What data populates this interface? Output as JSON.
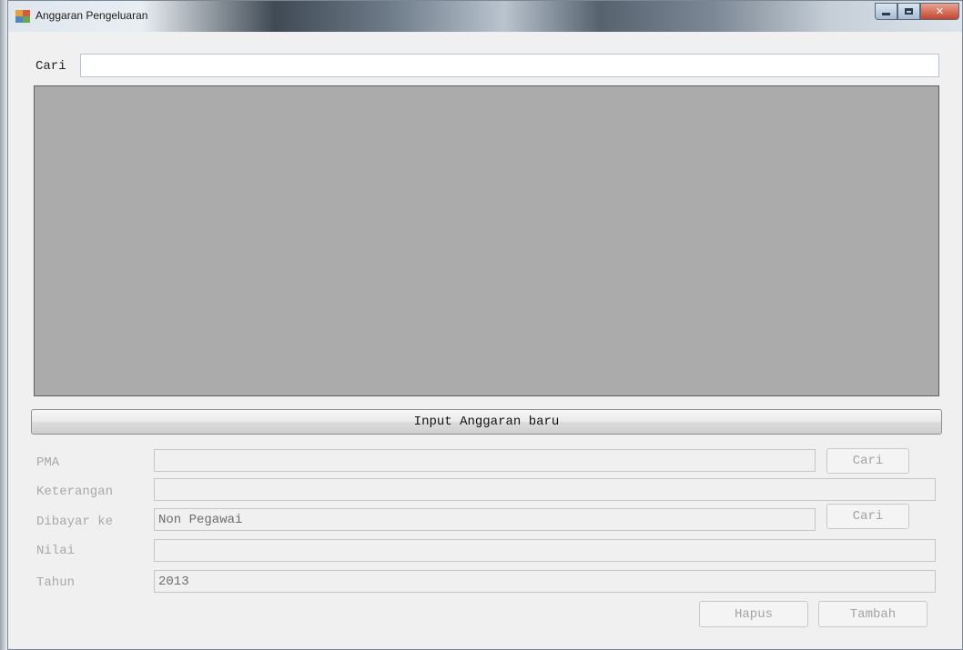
{
  "window": {
    "title": "Anggaran Pengeluaran"
  },
  "search": {
    "label": "Cari",
    "value": ""
  },
  "input_section": {
    "button_label": "Input Anggaran baru"
  },
  "form": {
    "pma": {
      "label": "PMA",
      "value": "",
      "search_button": "Cari"
    },
    "keterangan": {
      "label": "Keterangan",
      "value": ""
    },
    "dibayar_ke": {
      "label": "Dibayar ke",
      "value": "Non Pegawai",
      "search_button": "Cari"
    },
    "nilai": {
      "label": "Nilai",
      "value": ""
    },
    "tahun": {
      "label": "Tahun",
      "value": "2013"
    }
  },
  "actions": {
    "delete_label": "Hapus",
    "add_label": "Tambah"
  },
  "colors": {
    "grid_background": "#ababab",
    "window_background": "#f0f0f0",
    "disabled_text": "#a8a8a8"
  },
  "icons": {
    "window_icon": "app-form-icon",
    "minimize": "minimize-icon",
    "maximize": "maximize-icon",
    "close": "close-icon"
  }
}
